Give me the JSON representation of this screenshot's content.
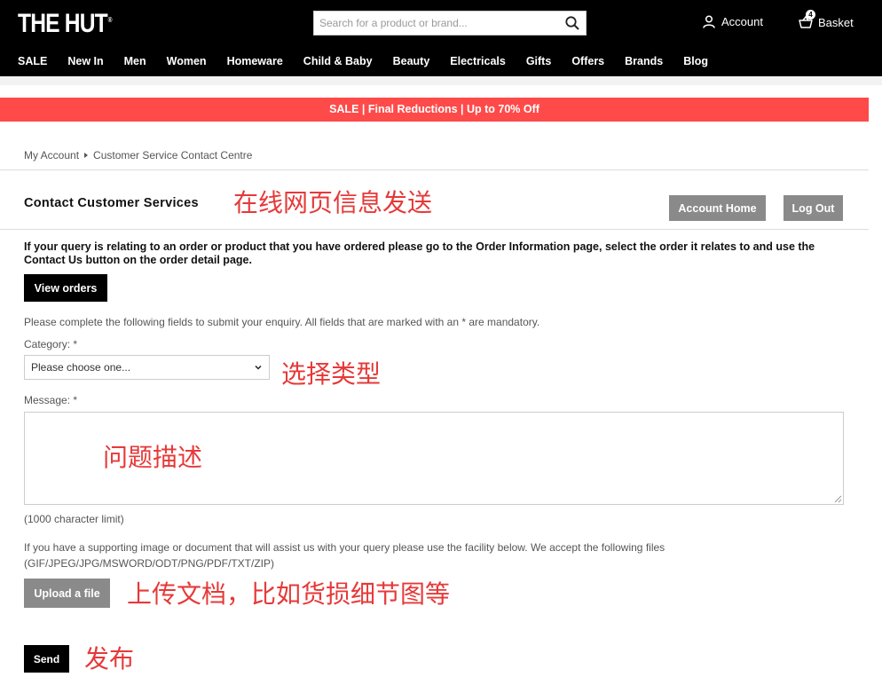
{
  "header": {
    "logo": "THE HUT",
    "logo_mark": "®",
    "search_placeholder": "Search for a product or brand...",
    "account_label": "Account",
    "basket_label": "Basket",
    "basket_count": "4"
  },
  "nav": {
    "items": [
      "SALE",
      "New In",
      "Men",
      "Women",
      "Homeware",
      "Child & Baby",
      "Beauty",
      "Electricals",
      "Gifts",
      "Offers",
      "Brands",
      "Blog"
    ]
  },
  "banner": {
    "text": "SALE | Final Reductions | Up to 70% Off"
  },
  "breadcrumb": {
    "items": [
      "My Account",
      "Customer Service Contact Centre"
    ]
  },
  "page": {
    "title": "Contact Customer Services",
    "account_home_button": "Account Home",
    "logout_button": "Log Out",
    "notice": "If your query is relating to an order or product that you have ordered please go to the Order Information page, select the order it relates to and use the Contact Us button on the order detail page.",
    "view_orders_button": "View orders",
    "instructions": "Please complete the following fields to submit your enquiry. All fields that are marked with an * are mandatory.",
    "category_label": "Category: *",
    "category_selected": "Please choose one...",
    "message_label": "Message: *",
    "char_limit": "(1000 character limit)",
    "upload_info_line1": "If you have a supporting image or document that will assist us with your query please use the facility below. We accept the following files",
    "upload_info_line2": "(GIF/JPEG/JPG/MSWORD/ODT/PNG/PDF/TXT/ZIP)",
    "upload_button": "Upload a file",
    "send_button": "Send"
  },
  "annotations": {
    "online_message": "在线网页信息发送",
    "choose_type": "选择类型",
    "describe_problem": "问题描述",
    "upload_docs": "上传文档，比如货损细节图等",
    "publish": "发布"
  },
  "colors": {
    "header_bg": "#000000",
    "banner_bg": "#ff4a4a",
    "annotation": "#e63939",
    "grey_button": "#8a8a8a"
  }
}
